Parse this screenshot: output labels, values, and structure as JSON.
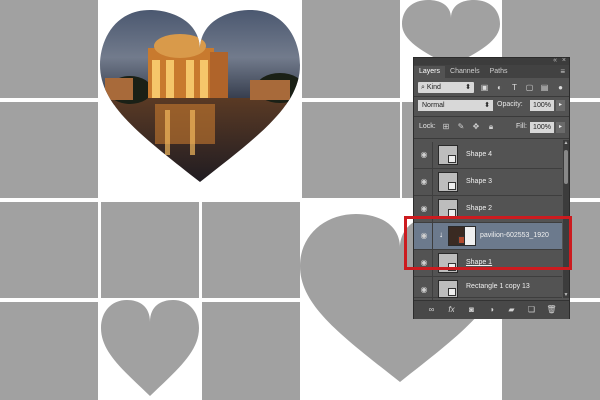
{
  "panel": {
    "tabs": [
      {
        "label": "Layers",
        "active": true
      },
      {
        "label": "Channels",
        "active": false
      },
      {
        "label": "Paths",
        "active": false
      }
    ],
    "menu_icon": "panel-menu-icon",
    "filter": {
      "kind_label": "Kind",
      "icons": [
        "image-filter-icon",
        "adjustment-filter-icon",
        "type-filter-icon",
        "shape-filter-icon",
        "smart-object-filter-icon"
      ]
    },
    "blend_mode": "Normal",
    "opacity_label": "Opacity:",
    "opacity_value": "100%",
    "lock_label": "Lock:",
    "lock_icons": [
      "lock-transparent-icon",
      "lock-image-icon",
      "lock-position-icon",
      "lock-all-icon"
    ],
    "fill_label": "Fill:",
    "fill_value": "100%",
    "layers": [
      {
        "name": "Shape 4",
        "selected": false
      },
      {
        "name": "Shape 3",
        "selected": false
      },
      {
        "name": "Shape 2",
        "selected": false
      },
      {
        "name": "pavilion-602553_1920",
        "selected": true
      },
      {
        "name": "Shape 1",
        "selected": false
      },
      {
        "name": "Rectangle 1 copy 13",
        "selected": false
      }
    ],
    "bottom_icons": [
      "link-icon",
      "fx-icon",
      "mask-icon",
      "adjustment-icon",
      "folder-icon",
      "new-layer-icon",
      "trash-icon"
    ],
    "bottom_labels": {
      "fx": "fx"
    }
  },
  "colors": {
    "tile": "#a1a1a1",
    "panel_bg": "#535353",
    "selected_layer": "#6c7a8d",
    "highlight": "#cc1b1f"
  }
}
